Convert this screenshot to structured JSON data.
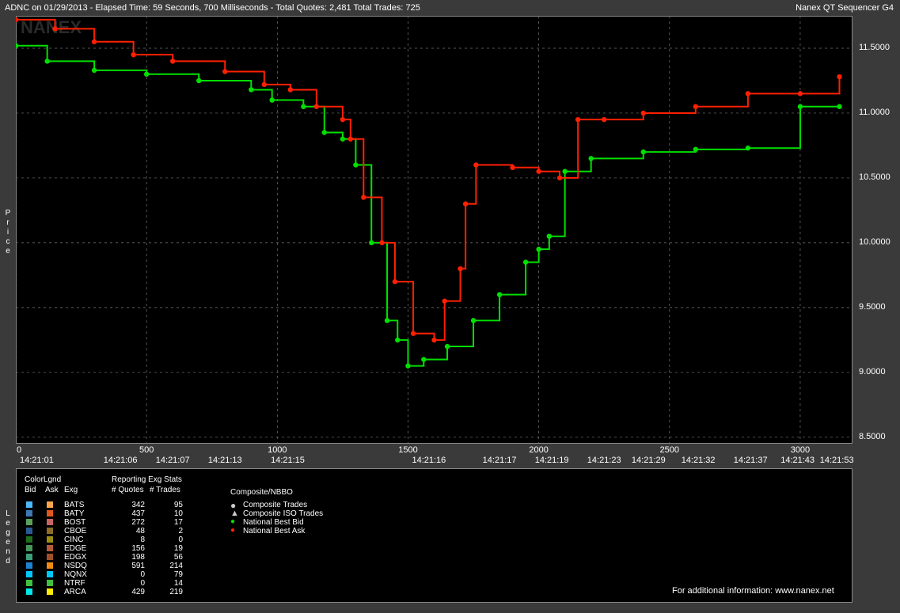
{
  "header": {
    "left": "ADNC on 01/29/2013  -  Elapsed Time: 59 Seconds, 700 Milliseconds  -  Total Quotes: 2,481  Total Trades: 725",
    "right": "Nanex QT Sequencer G4"
  },
  "watermark": "NANEX",
  "y_axis_label": "Price",
  "legend_side_label": "Legend",
  "chart_data": {
    "type": "line",
    "title": "ADNC on 01/29/2013",
    "ylabel": "Price",
    "ylim": [
      8.45,
      11.75
    ],
    "xlim": [
      0,
      3200
    ],
    "y_ticks": [
      "11.5000",
      "11.0000",
      "10.5000",
      "10.0000",
      "9.5000",
      "9.0000",
      "8.5000"
    ],
    "x_ticks": [
      "0",
      "500",
      "1000",
      "1500",
      "2000",
      "2500",
      "3000"
    ],
    "time_ticks": [
      {
        "x": 80,
        "label": "14:21:01"
      },
      {
        "x": 400,
        "label": "14:21:06"
      },
      {
        "x": 600,
        "label": "14:21:07"
      },
      {
        "x": 800,
        "label": "14:21:13"
      },
      {
        "x": 1040,
        "label": "14:21:15"
      },
      {
        "x": 1580,
        "label": "14:21:16"
      },
      {
        "x": 1850,
        "label": "14:21:17"
      },
      {
        "x": 2050,
        "label": "14:21:19"
      },
      {
        "x": 2250,
        "label": "14:21:23"
      },
      {
        "x": 2420,
        "label": "14:21:29"
      },
      {
        "x": 2610,
        "label": "14:21:32"
      },
      {
        "x": 2810,
        "label": "14:21:37"
      },
      {
        "x": 2990,
        "label": "14:21:43"
      },
      {
        "x": 3140,
        "label": "14:21:53"
      }
    ],
    "series": [
      {
        "name": "National Best Bid",
        "color": "#00e000",
        "x": [
          0,
          120,
          300,
          500,
          700,
          900,
          980,
          1100,
          1180,
          1250,
          1300,
          1360,
          1420,
          1460,
          1500,
          1560,
          1650,
          1750,
          1850,
          1950,
          2000,
          2040,
          2100,
          2200,
          2400,
          2600,
          2800,
          3000,
          3150
        ],
        "y": [
          11.52,
          11.4,
          11.33,
          11.3,
          11.25,
          11.18,
          11.1,
          11.05,
          10.85,
          10.8,
          10.6,
          10.0,
          9.4,
          9.25,
          9.05,
          9.1,
          9.2,
          9.4,
          9.6,
          9.85,
          9.95,
          10.05,
          10.55,
          10.65,
          10.7,
          10.72,
          10.73,
          11.05,
          11.05
        ]
      },
      {
        "name": "National Best Ask",
        "color": "#ff2000",
        "x": [
          0,
          150,
          300,
          450,
          600,
          800,
          950,
          1050,
          1150,
          1250,
          1280,
          1330,
          1400,
          1450,
          1520,
          1600,
          1640,
          1700,
          1720,
          1760,
          1900,
          2000,
          2080,
          2150,
          2250,
          2400,
          2600,
          2800,
          3000,
          3150
        ],
        "y": [
          11.72,
          11.65,
          11.55,
          11.45,
          11.4,
          11.32,
          11.22,
          11.18,
          11.05,
          10.95,
          10.8,
          10.35,
          10.0,
          9.7,
          9.3,
          9.25,
          9.55,
          9.8,
          10.3,
          10.6,
          10.58,
          10.55,
          10.5,
          10.95,
          10.95,
          11.0,
          11.05,
          11.15,
          11.15,
          11.28
        ]
      }
    ],
    "legend": {
      "headers": [
        "ColorLgnd",
        "Reporting Exg Stats",
        "Composite/NBBO"
      ],
      "subheaders": [
        "Bid",
        "Ask",
        "Exg",
        "# Quotes",
        "# Trades"
      ],
      "exchanges": [
        {
          "exg": "BATS",
          "quotes": "342",
          "trades": "95",
          "bid_color": "#4db8ff",
          "ask_color": "#ffa64d"
        },
        {
          "exg": "BATY",
          "quotes": "437",
          "trades": "10",
          "bid_color": "#3c78b4",
          "ask_color": "#e0581e"
        },
        {
          "exg": "BOST",
          "quotes": "272",
          "trades": "17",
          "bid_color": "#5aa05a",
          "ask_color": "#c86464"
        },
        {
          "exg": "CBOE",
          "quotes": "48",
          "trades": "2",
          "bid_color": "#285a96",
          "ask_color": "#8c6e28"
        },
        {
          "exg": "CINC",
          "quotes": "8",
          "trades": "0",
          "bid_color": "#1e6e1e",
          "ask_color": "#9c8c14"
        },
        {
          "exg": "EDGE",
          "quotes": "156",
          "trades": "19",
          "bid_color": "#46965a",
          "ask_color": "#b45a3c"
        },
        {
          "exg": "EDGX",
          "quotes": "198",
          "trades": "56",
          "bid_color": "#3ca078",
          "ask_color": "#a05028"
        },
        {
          "exg": "NSDQ",
          "quotes": "591",
          "trades": "214",
          "bid_color": "#1e82d2",
          "ask_color": "#f08c14"
        },
        {
          "exg": "NQNX",
          "quotes": "0",
          "trades": "79",
          "bid_color": "#00c8ff",
          "ask_color": "#00c8ff"
        },
        {
          "exg": "NTRF",
          "quotes": "0",
          "trades": "14",
          "bid_color": "#40c040",
          "ask_color": "#40c040"
        },
        {
          "exg": "ARCA",
          "quotes": "429",
          "trades": "219",
          "bid_color": "#00e8e8",
          "ask_color": "#ffee00"
        }
      ],
      "composite": [
        "Composite Trades",
        "Composite ISO Trades",
        "National Best Bid",
        "National Best Ask"
      ],
      "footer": "For additional information: www.nanex.net"
    }
  }
}
